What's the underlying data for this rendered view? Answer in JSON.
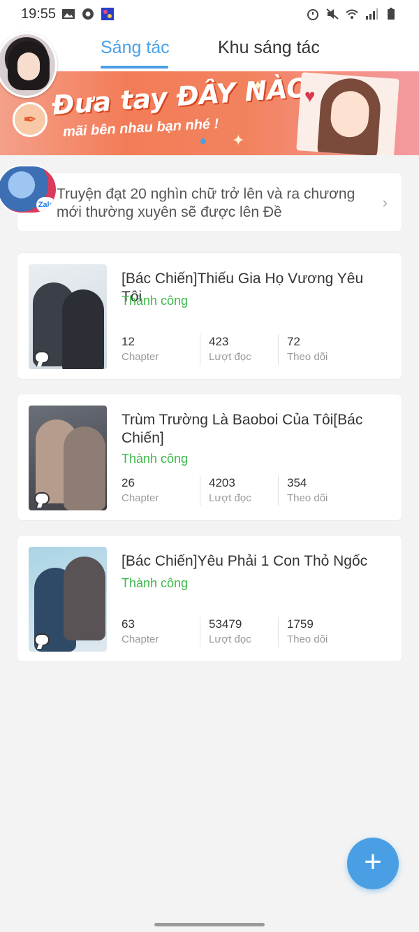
{
  "status_bar": {
    "time": "19:55",
    "left_icons": [
      "image-icon",
      "chrome-icon",
      "app-icon"
    ],
    "right_icons": [
      "alarm-icon",
      "mute-icon",
      "wifi-icon",
      "signal-icon",
      "battery-icon"
    ]
  },
  "header": {
    "tabs": [
      {
        "label": "Sáng tác",
        "active": true
      },
      {
        "label": "Khu sáng tác",
        "active": false
      }
    ],
    "accent_color": "#4a9fe4"
  },
  "banner": {
    "title": "Đưa tay ĐÂY NÀO",
    "subtitle": "mãi bên nhau bạn nhé !"
  },
  "notice": {
    "text": "Truyện đạt 20 nghìn chữ trở lên và ra chương mới thường xuyên sẽ được lên Đề",
    "badge": "Zalo"
  },
  "stories": [
    {
      "title": "[Bác Chiến]Thiếu Gia Họ Vương Yêu Tôi",
      "status": "Thành công",
      "stats": [
        {
          "value": "12",
          "label": "Chapter"
        },
        {
          "value": "423",
          "label": "Lượt đọc"
        },
        {
          "value": "72",
          "label": "Theo dõi"
        }
      ]
    },
    {
      "title": "Trùm Trường Là Baoboi Của Tôi[Bác Chiến]",
      "status": "Thành công",
      "stats": [
        {
          "value": "26",
          "label": "Chapter"
        },
        {
          "value": "4203",
          "label": "Lượt đọc"
        },
        {
          "value": "354",
          "label": "Theo dõi"
        }
      ]
    },
    {
      "title": "[Bác Chiến]Yêu Phải 1 Con Thỏ Ngốc",
      "status": "Thành công",
      "stats": [
        {
          "value": "63",
          "label": "Chapter"
        },
        {
          "value": "53479",
          "label": "Lượt đọc"
        },
        {
          "value": "1759",
          "label": "Theo dõi"
        }
      ]
    }
  ],
  "fab": {
    "label": "+",
    "icon": "plus-icon"
  },
  "colors": {
    "success": "#3cb84a",
    "accent": "#4a9fe4"
  }
}
